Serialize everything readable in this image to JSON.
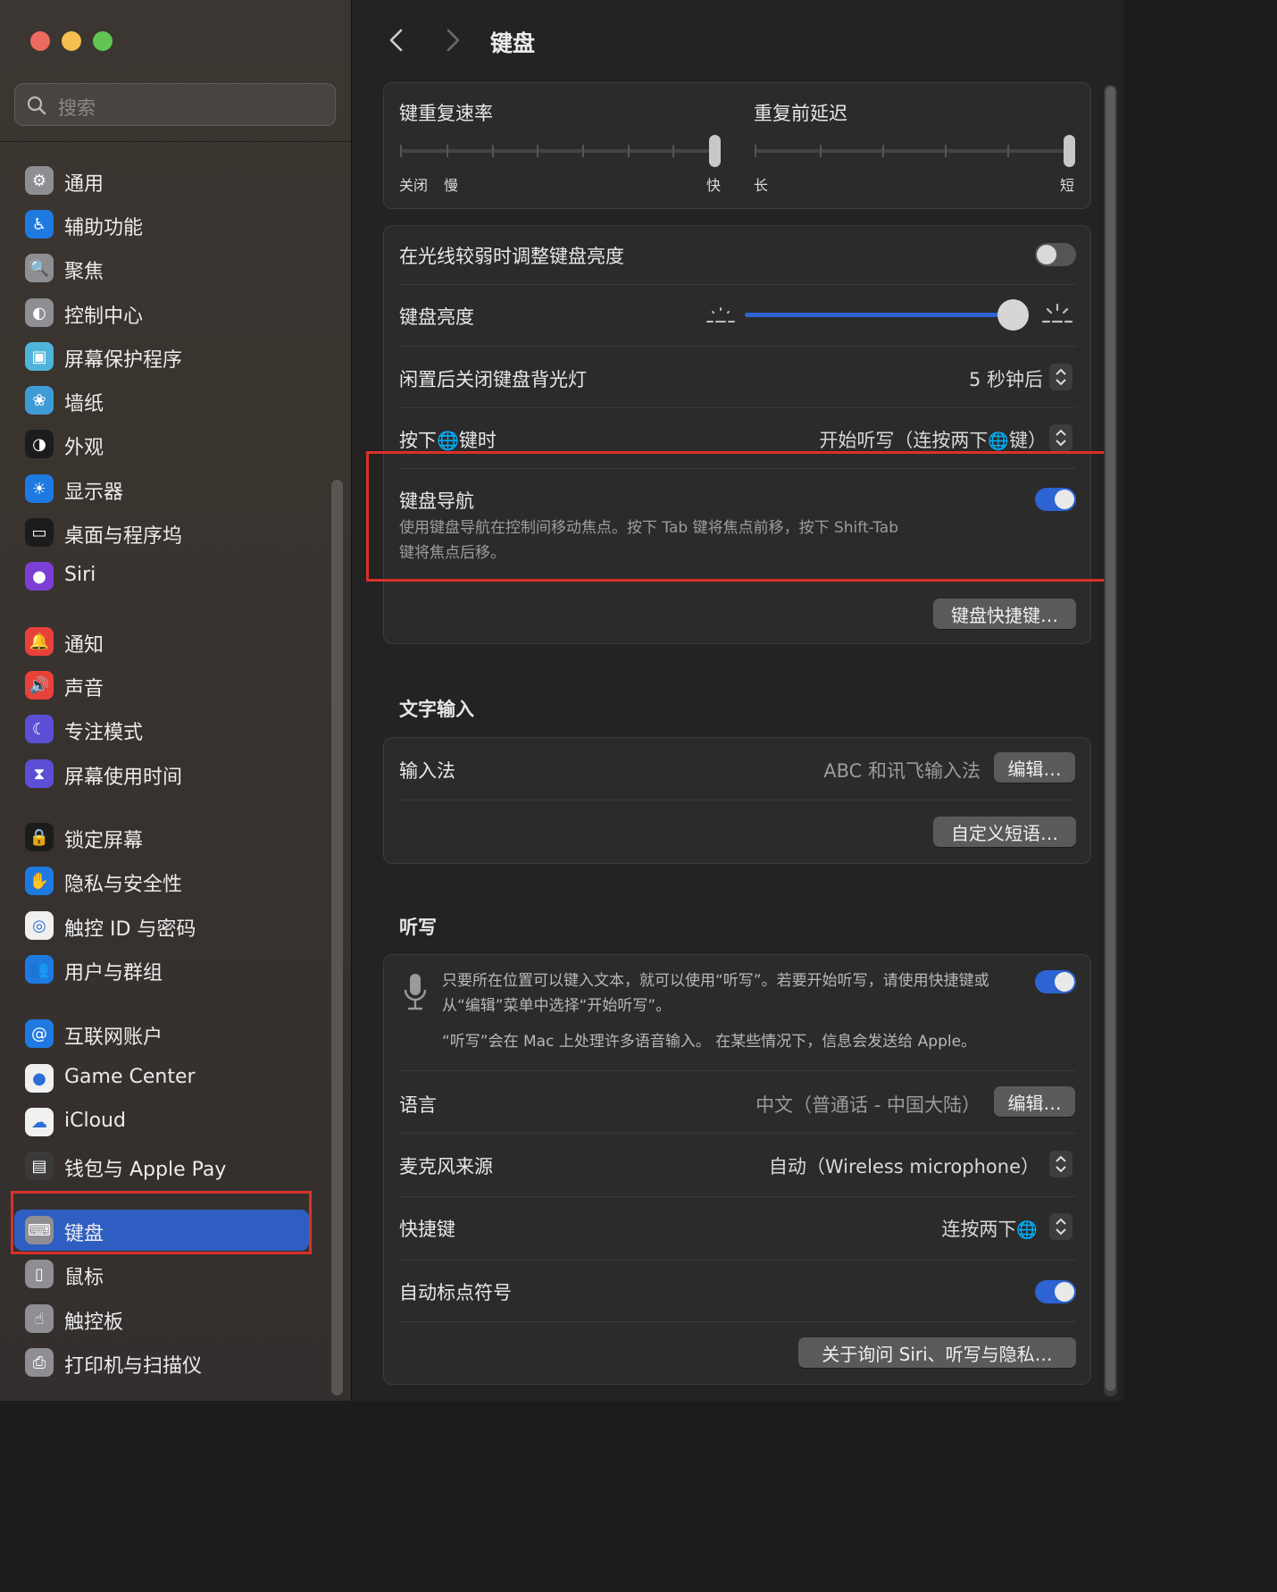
{
  "window": {
    "title": "键盘"
  },
  "sidebar": {
    "search_placeholder": "搜索",
    "items": [
      {
        "label": "通用",
        "icon": "gear-icon",
        "color": "#8e8e93"
      },
      {
        "label": "辅助功能",
        "icon": "accessibility-icon",
        "color": "#1e7ae0"
      },
      {
        "label": "聚焦",
        "icon": "spotlight-icon",
        "color": "#8e8e93"
      },
      {
        "label": "控制中心",
        "icon": "control-center-icon",
        "color": "#8e8e93"
      },
      {
        "label": "屏幕保护程序",
        "icon": "screensaver-icon",
        "color": "#4fb4d9"
      },
      {
        "label": "墙纸",
        "icon": "wallpaper-icon",
        "color": "#3f9bd6"
      },
      {
        "label": "外观",
        "icon": "appearance-icon",
        "color": "#1c1c1c"
      },
      {
        "label": "显示器",
        "icon": "display-icon",
        "color": "#1e7ae0"
      },
      {
        "label": "桌面与程序坞",
        "icon": "dock-icon",
        "color": "#1c1c1c"
      },
      {
        "label": "Siri",
        "icon": "siri-icon",
        "color": "#7b3fd6"
      },
      {
        "label": "通知",
        "icon": "notification-icon",
        "color": "#e8413a"
      },
      {
        "label": "声音",
        "icon": "sound-icon",
        "color": "#e8413a"
      },
      {
        "label": "专注模式",
        "icon": "focus-moon-icon",
        "color": "#5b4fd6"
      },
      {
        "label": "屏幕使用时间",
        "icon": "hourglass-icon",
        "color": "#5b4fd6"
      },
      {
        "label": "锁定屏幕",
        "icon": "lock-icon",
        "color": "#1c1c1c"
      },
      {
        "label": "隐私与安全性",
        "icon": "hand-icon",
        "color": "#1e7ae0"
      },
      {
        "label": "触控 ID 与密码",
        "icon": "fingerprint-icon",
        "color": "#f0f0f0"
      },
      {
        "label": "用户与群组",
        "icon": "users-icon",
        "color": "#1e7ae0"
      },
      {
        "label": "互联网账户",
        "icon": "at-icon",
        "color": "#1e7ae0"
      },
      {
        "label": "Game Center",
        "icon": "game-center-icon",
        "color": "#f0f0f0"
      },
      {
        "label": "iCloud",
        "icon": "icloud-icon",
        "color": "#f0f0f0"
      },
      {
        "label": "钱包与 Apple Pay",
        "icon": "wallet-icon",
        "color": "#3a3a3a"
      },
      {
        "label": "键盘",
        "icon": "keyboard-icon",
        "color": "#8e8e93"
      },
      {
        "label": "鼠标",
        "icon": "mouse-icon",
        "color": "#8e8e93"
      },
      {
        "label": "触控板",
        "icon": "trackpad-icon",
        "color": "#8e8e93"
      },
      {
        "label": "打印机与扫描仪",
        "icon": "printer-icon",
        "color": "#8e8e93"
      }
    ],
    "selected": "键盘"
  },
  "keyboard": {
    "repeat_rate": {
      "label": "键重复速率",
      "min_label": "关闭",
      "slow_label": "慢",
      "max_label": "快",
      "value_fraction": 1.0
    },
    "repeat_delay": {
      "label": "重复前延迟",
      "min_label": "长",
      "max_label": "短",
      "value_fraction": 1.0
    },
    "adjust_brightness": {
      "label": "在光线较弱时调整键盘亮度",
      "on": false
    },
    "brightness": {
      "label": "键盘亮度",
      "value_fraction": 0.9
    },
    "backlight_off": {
      "label": "闲置后关闭键盘背光灯",
      "value": "5 秒钟后"
    },
    "globe_key": {
      "label_before": "按下",
      "label_after": "键时",
      "value_before": "开始听写（连按两下",
      "value_after": "键）"
    },
    "keyboard_navigation": {
      "label": "键盘导航",
      "on": true,
      "description_line1": "使用键盘导航在控制间移动焦点。按下 Tab 键将焦点前移，按下 Shift-Tab",
      "description_line2": "键将焦点后移。"
    },
    "shortcuts_button": "键盘快捷键…"
  },
  "text_input": {
    "title": "文字输入",
    "input_sources": {
      "label": "输入法",
      "value": "ABC 和讯飞输入法",
      "button": "编辑…"
    },
    "text_replacements_button": "自定义短语…"
  },
  "dictation": {
    "title": "听写",
    "on": true,
    "description_line1": "只要所在位置可以键入文本，就可以使用“听写”。若要开始听写，请使用快捷键或",
    "description_line2": "从“编辑”菜单中选择“开始听写”。",
    "privacy_note": "“听写”会在 Mac 上处理许多语音输入。 在某些情况下，信息会发送给 Apple。",
    "language": {
      "label": "语言",
      "value": "中文（普通话 - 中国大陆）",
      "button": "编辑…"
    },
    "mic_source": {
      "label": "麦克风来源",
      "value": "自动（Wireless microphone）"
    },
    "shortcut": {
      "label": "快捷键",
      "value": "连按两下"
    },
    "auto_punctuation": {
      "label": "自动标点符号",
      "on": true
    },
    "about_button": "关于询问 Siri、听写与隐私…"
  },
  "colors": {
    "accent": "#2d63d3",
    "highlight_box": "#d9312a",
    "sidebar_selected": "#2f5ec2"
  }
}
